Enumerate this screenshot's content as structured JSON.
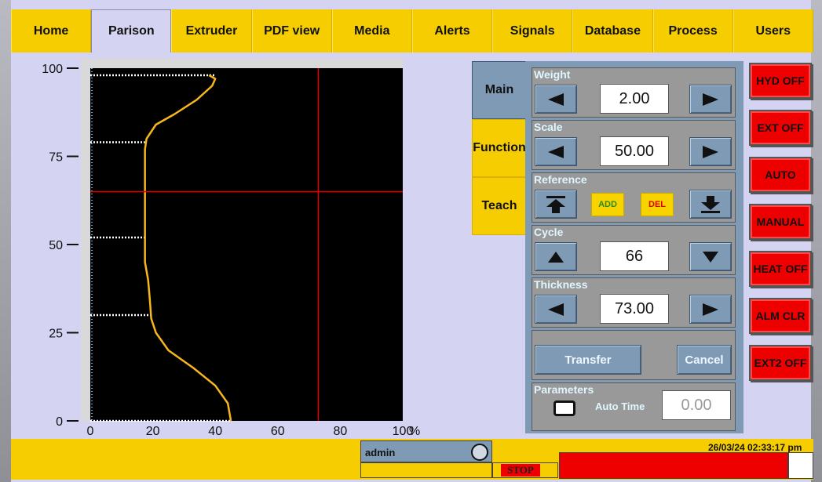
{
  "nav": {
    "tabs": [
      "Home",
      "Parison",
      "Extruder",
      "PDF view",
      "Media",
      "Alerts",
      "Signals",
      "Database",
      "Process",
      "Users"
    ],
    "active": "Parison"
  },
  "side_tabs": {
    "main": "Main",
    "function": "Function",
    "teach": "Teach"
  },
  "panel": {
    "weight": {
      "label": "Weight",
      "value": "2.00"
    },
    "scale": {
      "label": "Scale",
      "value": "50.00"
    },
    "reference": {
      "label": "Reference",
      "add": "ADD",
      "del": "DEL"
    },
    "cycle": {
      "label": "Cycle",
      "value": "66"
    },
    "thickness": {
      "label": "Thickness",
      "value": "73.00"
    },
    "transfer": "Transfer",
    "cancel": "Cancel",
    "parameters": {
      "label": "Parameters",
      "auto_time_label": "Auto Time",
      "auto_time_value": "0.00"
    }
  },
  "right_buttons": [
    "HYD OFF",
    "EXT OFF",
    "AUTO",
    "MANUAL",
    "HEAT OFF",
    "ALM CLR",
    "EXT2 OFF"
  ],
  "status": {
    "user": "admin",
    "stop": "STOP",
    "datetime": "26/03/24 02:33:17 pm",
    "alarm_text": ""
  },
  "colors": {
    "nav_yellow": "#f5cd00",
    "panel_blue": "#7f9ab5",
    "alarm_red": "#ee0000",
    "curve": "#f6b71a",
    "crosshair": "#e00000"
  },
  "chart_data": {
    "type": "line",
    "title": "",
    "xlabel": "",
    "x_unit": "%",
    "ylabel": "",
    "xlim": [
      0,
      100
    ],
    "ylim": [
      0,
      100
    ],
    "x_ticks": [
      0,
      20,
      40,
      60,
      80,
      100
    ],
    "y_ticks": [
      0,
      25,
      50,
      75,
      100
    ],
    "series": [
      {
        "x": [
          45,
          44,
          40,
          33,
          25,
          21,
          19.5,
          19,
          18.5,
          17.5,
          17.5,
          17.5,
          17.5,
          17.5,
          17.5,
          18,
          21,
          27,
          34,
          39,
          40,
          38
        ],
        "y": [
          0,
          5,
          10,
          15,
          20,
          25,
          29,
          35,
          40,
          45,
          52,
          60,
          66,
          72,
          77,
          80,
          84,
          87,
          91,
          95,
          97,
          98
        ]
      }
    ],
    "dotted_lines_y": [
      0,
      30,
      52,
      79,
      98
    ],
    "dotted_lines_x_end": [
      45,
      19.5,
      17.5,
      17.5,
      40
    ],
    "crosshair": {
      "x": 73,
      "y": 65
    }
  }
}
